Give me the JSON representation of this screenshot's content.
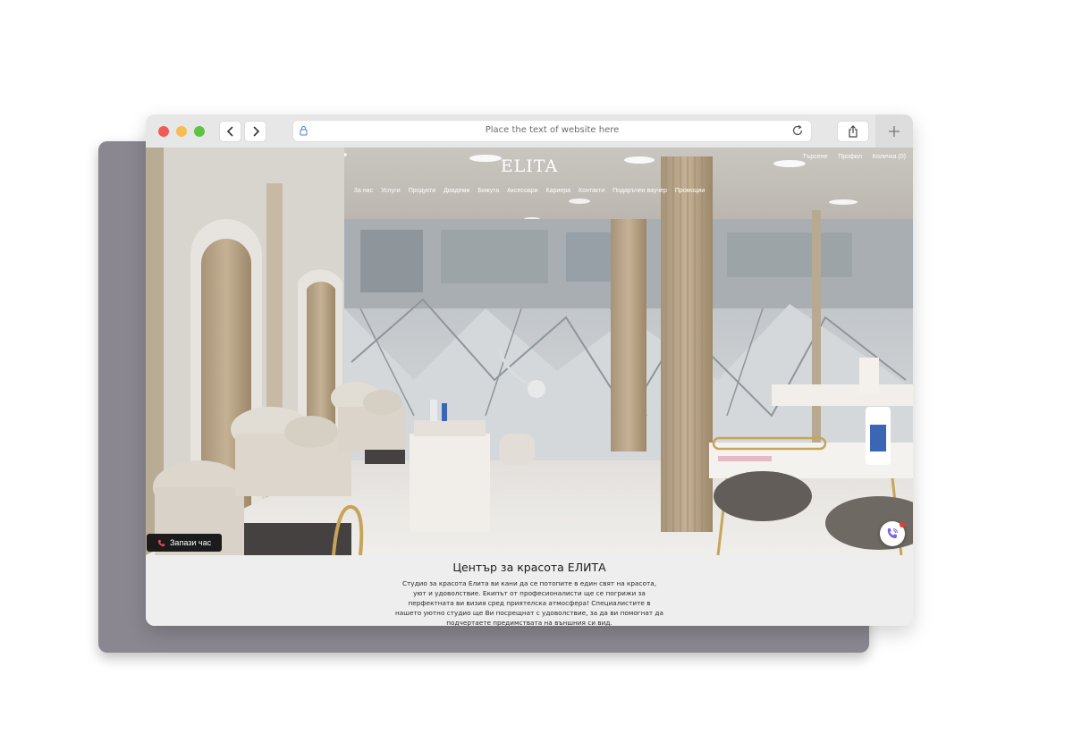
{
  "browser": {
    "address_text": "Place the text of website here",
    "icons": {
      "back": "chevron-left-icon",
      "forward": "chevron-right-icon",
      "lock": "lock-icon",
      "reload": "reload-icon",
      "share": "share-icon",
      "new_tab": "plus-icon"
    }
  },
  "site": {
    "logo": "ELITA",
    "top_links": [
      "Търсене",
      "Профил",
      "Количка (0)"
    ],
    "nav": [
      "За нас",
      "Услуги",
      "Продукти",
      "Диадеми",
      "Бижута",
      "Аксесоари",
      "Кариера",
      "Контакти",
      "Подаръчен ваучер",
      "Промоции"
    ],
    "book_button": "Запази час",
    "heading": "Център за красота ЕЛИТА",
    "intro": "Студио за красота Елита ви кани да се потопите в един свят на красота, уют и удоволствие. Екипът от професионалисти ще се погрижи за перфектната ви визия сред приятелска атмосфера! Специалистите в нашето уютно студио ще Ви посрещнат с удоволствие, за да ви помогнат да подчертаете предимствата на външния си вид."
  },
  "colors": {
    "accent_dark": "#1c1b1c",
    "viber_purple": "#7360f2",
    "notification_red": "#e63b2e"
  }
}
